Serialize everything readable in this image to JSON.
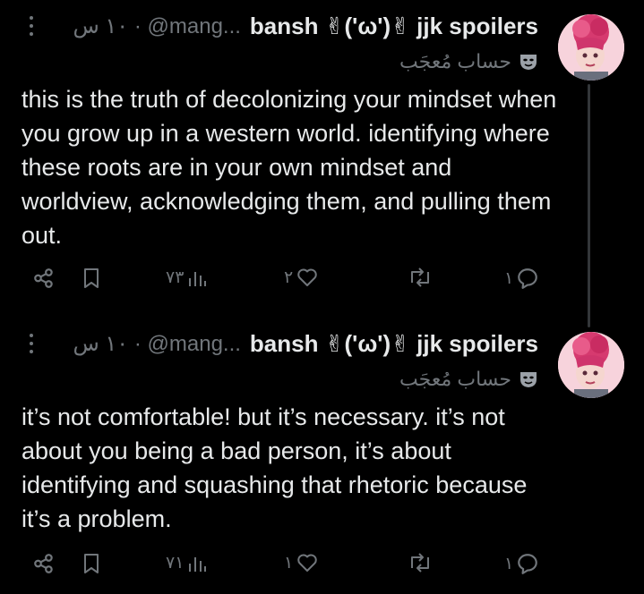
{
  "posts": [
    {
      "display_name": "bansh ✌︎('ω')✌︎ jjk spoilers",
      "handle_time": "١٠ س · @mang...",
      "badge_text": "حساب مُعجَب",
      "text": "this is the truth of decolonizing your mindset when you grow up in a western world. identifying where these roots are in your own mindset and worldview, acknowledging them, and pulling them out.",
      "counts": {
        "replies": "١",
        "reposts": "",
        "likes": "٢",
        "views": "٧٣"
      }
    },
    {
      "display_name": "bansh ✌︎('ω')✌︎ jjk spoilers",
      "handle_time": "١٠ س · @mang...",
      "badge_text": "حساب مُعجَب",
      "text": "it’s not comfortable! but it’s necessary. it’s not about you being a bad person, it’s about identifying and squashing that rhetoric because it’s a problem.",
      "counts": {
        "replies": "١",
        "reposts": "",
        "likes": "١",
        "views": "٧١"
      }
    }
  ],
  "icons": {
    "more": "more-vertical-icon",
    "share": "share-icon",
    "bookmark": "bookmark-icon",
    "views": "views-icon",
    "like": "heart-icon",
    "repost": "repost-icon",
    "reply": "reply-icon",
    "badge": "mask-icon"
  },
  "colors": {
    "background": "#000000",
    "text": "#e7e9ea",
    "muted": "#71767b",
    "avatar_bg": "#f4c9d3"
  }
}
